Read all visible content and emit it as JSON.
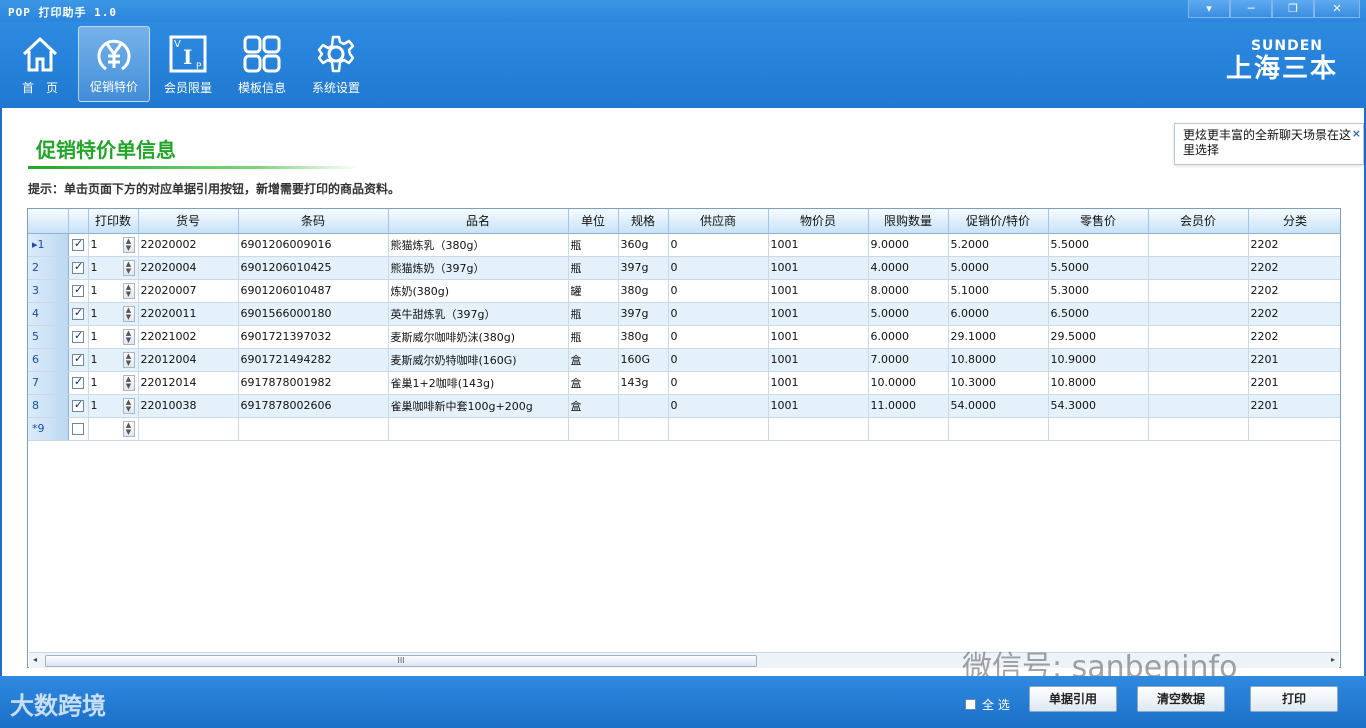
{
  "app": {
    "title": "POP 打印助手 1.0"
  },
  "window_controls": {
    "menu": "▾",
    "minimize": "─",
    "restore": "❐",
    "close": "✕"
  },
  "toolbar": {
    "items": [
      {
        "label": "首　页",
        "icon": "home-icon"
      },
      {
        "label": "促销特价",
        "icon": "yuan-icon",
        "active": true
      },
      {
        "label": "会员限量",
        "icon": "vip-icon"
      },
      {
        "label": "模板信息",
        "icon": "grid-icon"
      },
      {
        "label": "系统设置",
        "icon": "gear-icon"
      }
    ]
  },
  "brand": {
    "en": "SUNDEN",
    "cn": "上海三本"
  },
  "tooltip": {
    "text": "更炫更丰富的全新聊天场景在这里选择",
    "close": "×"
  },
  "page": {
    "title": "促销特价单信息",
    "hint": "提示：单击页面下方的对应单据引用按钮，新增需要打印的商品资料。"
  },
  "table": {
    "headers": [
      "",
      "",
      "打印数",
      "货号",
      "条码",
      "品名",
      "单位",
      "规格",
      "供应商",
      "物价员",
      "限购数量",
      "促销价/特价",
      "零售价",
      "会员价",
      "分类"
    ],
    "rows": [
      {
        "rh": "▸1",
        "checked": true,
        "qty": "1",
        "cells": [
          "22020002",
          "6901206009016",
          "熊猫炼乳（380g）",
          "瓶",
          "360g",
          "0",
          "1001",
          "9.0000",
          "5.2000",
          "5.5000",
          "",
          "2202"
        ]
      },
      {
        "rh": "2",
        "checked": true,
        "qty": "1",
        "cells": [
          "22020004",
          "6901206010425",
          "熊猫炼奶（397g）",
          "瓶",
          "397g",
          "0",
          "1001",
          "4.0000",
          "5.0000",
          "5.5000",
          "",
          "2202"
        ]
      },
      {
        "rh": "3",
        "checked": true,
        "qty": "1",
        "cells": [
          "22020007",
          "6901206010487",
          "炼奶(380g)",
          "罐",
          "380g",
          "0",
          "1001",
          "8.0000",
          "5.1000",
          "5.3000",
          "",
          "2202"
        ]
      },
      {
        "rh": "4",
        "checked": true,
        "qty": "1",
        "cells": [
          "22020011",
          "6901566000180",
          "英牛甜炼乳（397g）",
          "瓶",
          "397g",
          "0",
          "1001",
          "5.0000",
          "6.0000",
          "6.5000",
          "",
          "2202"
        ]
      },
      {
        "rh": "5",
        "checked": true,
        "qty": "1",
        "cells": [
          "22021002",
          "6901721397032",
          "麦斯威尔咖啡奶沫(380g)",
          "瓶",
          "380g",
          "0",
          "1001",
          "6.0000",
          "29.1000",
          "29.5000",
          "",
          "2202"
        ]
      },
      {
        "rh": "6",
        "checked": true,
        "qty": "1",
        "cells": [
          "22012004",
          "6901721494282",
          "麦斯威尔奶特咖啡(160G)",
          "盒",
          "160G",
          "0",
          "1001",
          "7.0000",
          "10.8000",
          "10.9000",
          "",
          "2201"
        ]
      },
      {
        "rh": "7",
        "checked": true,
        "qty": "1",
        "cells": [
          "22012014",
          "6917878001982",
          "雀巢1+2咖啡(143g)",
          "盒",
          "143g",
          "0",
          "1001",
          "10.0000",
          "10.3000",
          "10.8000",
          "",
          "2201"
        ]
      },
      {
        "rh": "8",
        "checked": true,
        "qty": "1",
        "cells": [
          "22010038",
          "6917878002606",
          "雀巢咖啡新中套100g+200g",
          "盒",
          "",
          "0",
          "1001",
          "11.0000",
          "54.0000",
          "54.3000",
          "",
          "2201"
        ]
      },
      {
        "rh": "*9",
        "checked": false,
        "qty": "",
        "cells": [
          "",
          "",
          "",
          "",
          "",
          "",
          "",
          "",
          "",
          "",
          "",
          ""
        ]
      }
    ]
  },
  "scrollbar": {
    "left": "◂",
    "right": "▸",
    "grip": "III"
  },
  "bottom": {
    "select_all": "全 选",
    "btn_ref": "单据引用",
    "btn_clear": "清空数据",
    "btn_print": "打印"
  },
  "watermarks": {
    "logo": "大数跨境",
    "wechat": "微信号: sanbeninfo"
  }
}
